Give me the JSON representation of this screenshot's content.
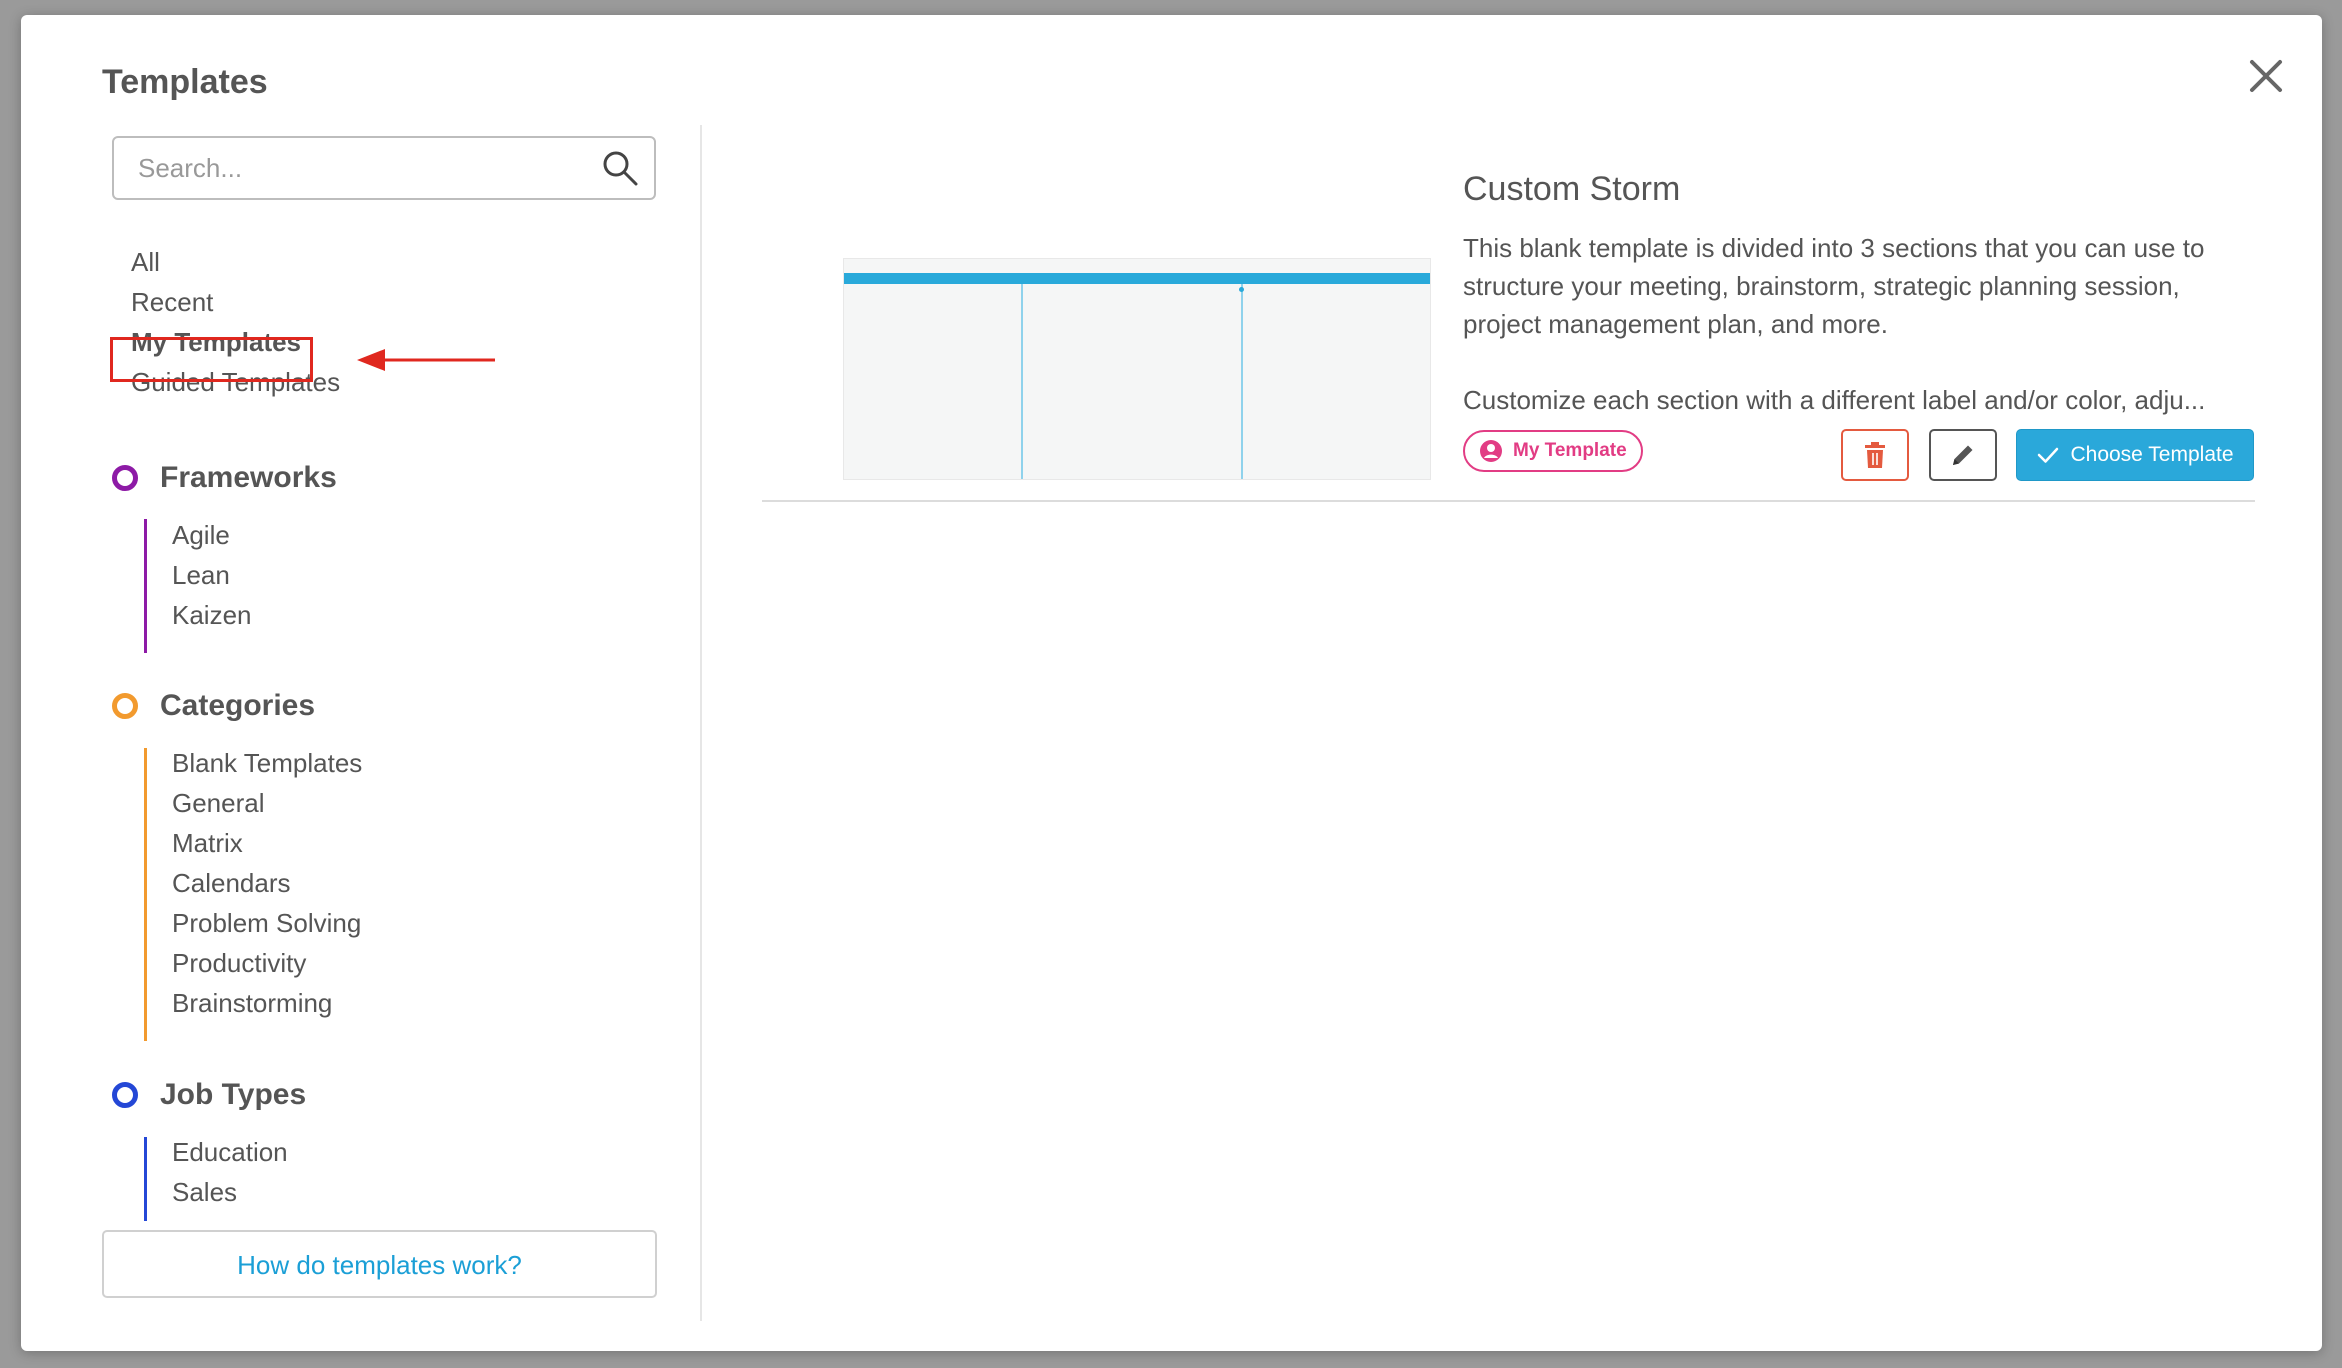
{
  "colors": {
    "frameworks": "#8d1aa6",
    "categories": "#f29a2e",
    "job_types": "#2447d6",
    "accent": "#2aa8da",
    "badge": "#e23c84",
    "delete": "#e45a3f",
    "highlight": "#e0281f"
  },
  "sidebar": {
    "title": "Templates",
    "search": {
      "placeholder": "Search...",
      "icon": "search-icon"
    },
    "links": [
      {
        "label": "All"
      },
      {
        "label": "Recent"
      },
      {
        "label": "My Templates",
        "active": true
      },
      {
        "label": "Guided Templates"
      }
    ],
    "frameworks": {
      "title": "Frameworks",
      "items": [
        "Agile",
        "Lean",
        "Kaizen"
      ]
    },
    "categories": {
      "title": "Categories",
      "items": [
        "Blank Templates",
        "General",
        "Matrix",
        "Calendars",
        "Problem Solving",
        "Productivity",
        "Brainstorming"
      ]
    },
    "job_types": {
      "title": "Job Types",
      "items": [
        "Education",
        "Sales"
      ]
    },
    "help_label": "How do templates work?"
  },
  "template": {
    "title": "Custom Storm",
    "description": "This blank template is divided into 3 sections that you can use to structure your meeting, brainstorm, strategic planning session, project management plan, and more.",
    "description2": "Customize each section with a different label and/or color, adju...",
    "badge_label": "My Template",
    "choose_label": "Choose Template"
  }
}
